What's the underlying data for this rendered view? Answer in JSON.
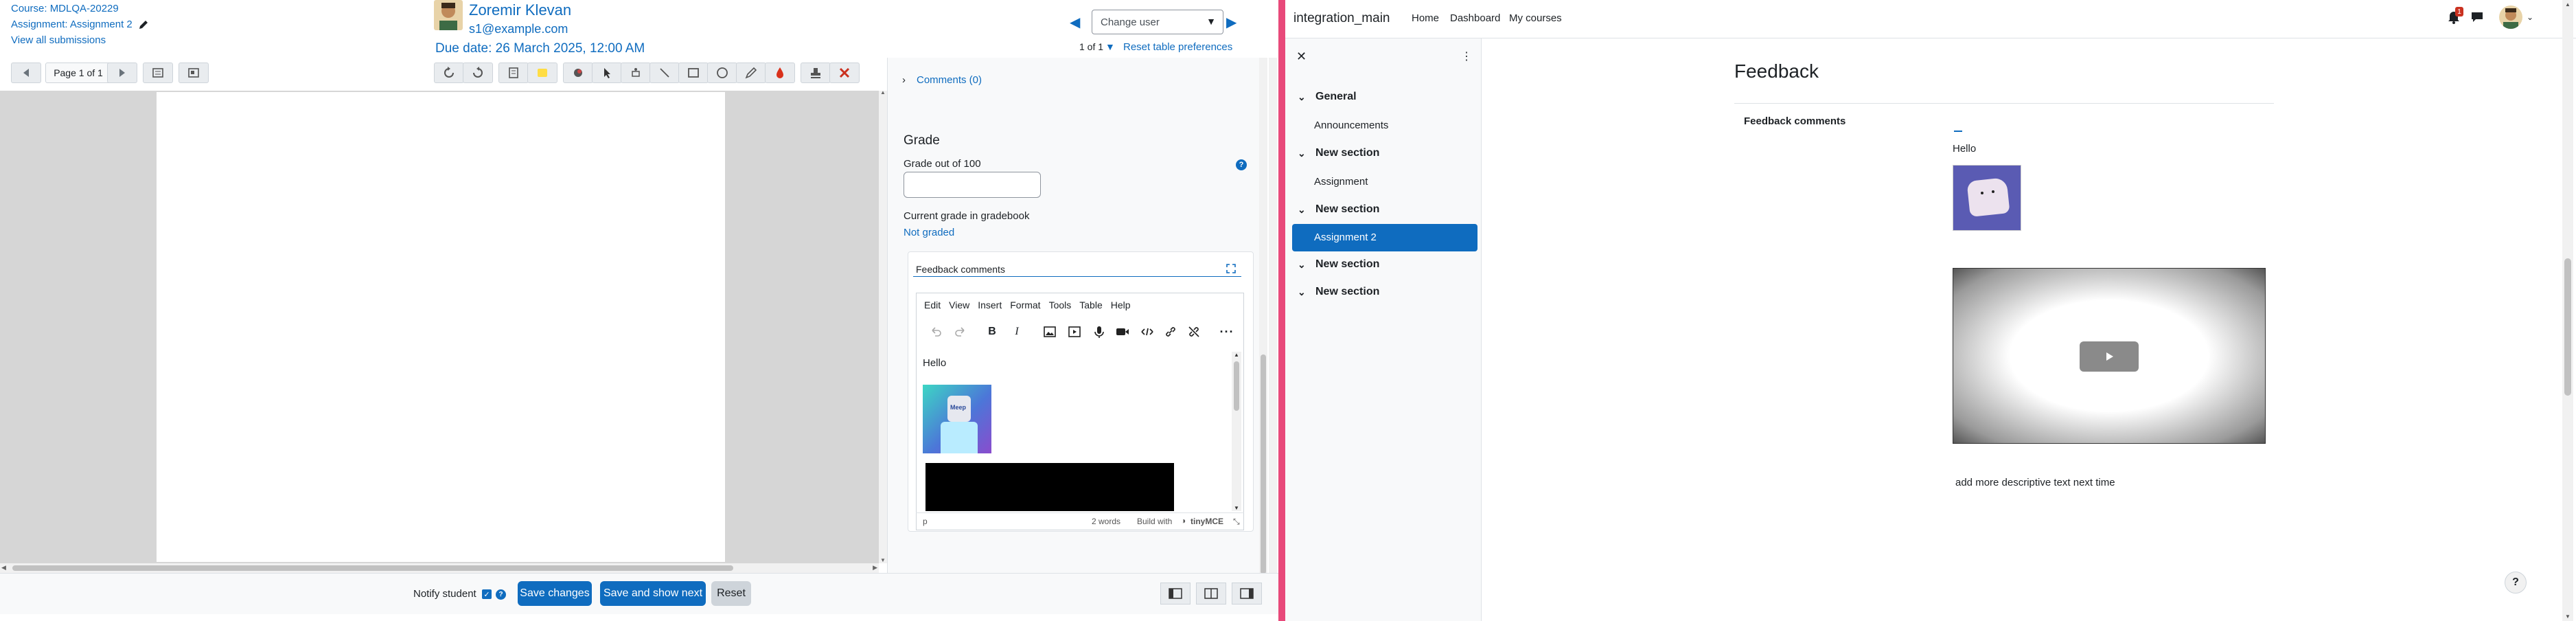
{
  "grader": {
    "course_link": "Course: MDLQA-20229",
    "assignment_link": "Assignment: Assignment 2",
    "view_all": "View all submissions",
    "user_name": "Zoremir Klevan",
    "user_email": "s1@example.com",
    "due_date": "Due date: 26 March 2025, 12:00 AM",
    "change_user_placeholder": "Change user",
    "pagination": "1 of 1",
    "reset_prefs": "Reset table preferences",
    "pdf_page_label": "Page 1 of 1",
    "comments_toggle": "Comments (0)",
    "grade_heading": "Grade",
    "grade_out_of": "Grade out of 100",
    "grade_value": "",
    "current_grade_label": "Current grade in gradebook",
    "current_grade_value": "Not graded",
    "feedback_label": "Feedback comments",
    "editor_menu": [
      "Edit",
      "View",
      "Insert",
      "Format",
      "Tools",
      "Table",
      "Help"
    ],
    "editor_text": "Hello",
    "editor_image_text": "Meep",
    "editor_path": "p",
    "editor_wordcount": "2 words",
    "editor_brand": "Build with",
    "editor_brand_name": "tinyMCE",
    "notify_label": "Notify student",
    "notify_checked": true,
    "save_changes": "Save changes",
    "save_next": "Save and show next",
    "reset": "Reset"
  },
  "student": {
    "site_name": "integration_main",
    "nav": [
      "Home",
      "Dashboard",
      "My courses"
    ],
    "notification_count": "1",
    "course_index": {
      "sections": [
        {
          "title": "General",
          "items": [
            "Announcements"
          ]
        },
        {
          "title": "New section",
          "items": [
            "Assignment"
          ]
        },
        {
          "title": "New section",
          "items": [
            "Assignment 2"
          ]
        },
        {
          "title": "New section",
          "items": []
        },
        {
          "title": "New section",
          "items": []
        }
      ],
      "active_item": "Assignment 2"
    },
    "page_heading": "Feedback",
    "feedback_comments_label": "Feedback comments",
    "feedback_text": "Hello",
    "feedback_note": "add more descriptive text next time",
    "help_label": "?"
  },
  "colors": {
    "accent": "#0f6cbf",
    "active_item_bg": "#0f6cbf",
    "divider_pink": "#e8497a",
    "pdf_bg": "#d6d6d6",
    "danger": "#ca3120"
  }
}
